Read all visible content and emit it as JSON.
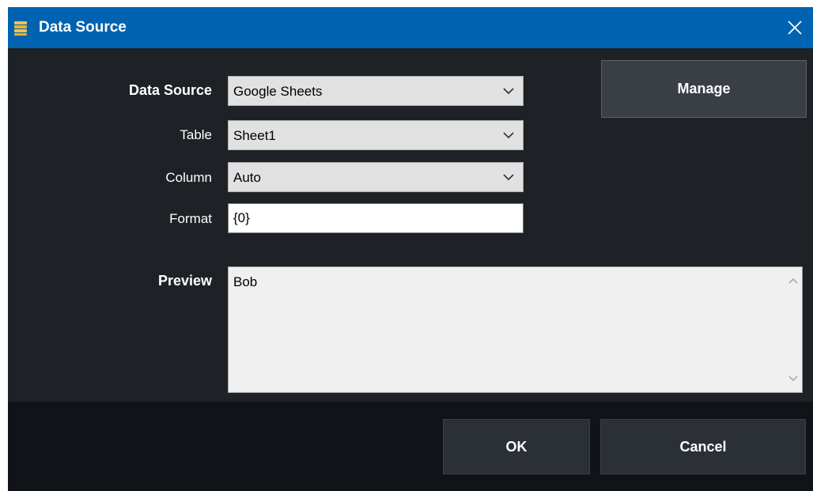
{
  "window": {
    "title": "Data Source",
    "icon": "database-icon",
    "close_icon": "close-icon"
  },
  "form": {
    "data_source": {
      "label": "Data Source",
      "value": "Google Sheets"
    },
    "table": {
      "label": "Table",
      "value": "Sheet1"
    },
    "column": {
      "label": "Column",
      "value": "Auto"
    },
    "format": {
      "label": "Format",
      "value": "{0}"
    }
  },
  "manage_label": "Manage",
  "preview": {
    "label": "Preview",
    "value": "Bob"
  },
  "footer": {
    "ok_label": "OK",
    "cancel_label": "Cancel"
  },
  "colors": {
    "titlebar": "#0063b1",
    "window_bg": "#1e2126",
    "footer_bg": "#101317",
    "button_bg": "#3a3f46"
  }
}
